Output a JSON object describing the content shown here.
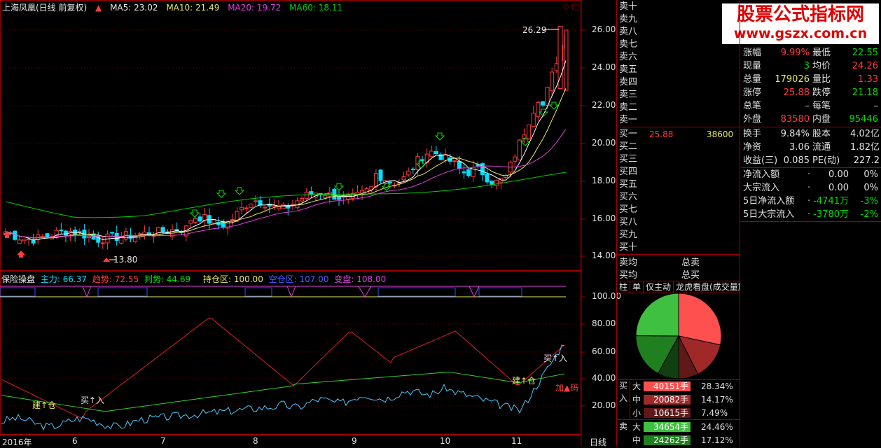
{
  "header": {
    "stock_title": "上海凤凰(日线 前复权)",
    "ma5": "MA5: 23.02",
    "ma10": "MA10: 21.49",
    "ma20": "MA20: 19.72",
    "ma60": "MA60: 18.11"
  },
  "main_chart": {
    "price_ticks": [
      "26.00",
      "24.00",
      "22.00",
      "20.00",
      "18.00",
      "16.00",
      "14.00"
    ],
    "high_label": "26.29",
    "low_label": "13.80"
  },
  "indicator": {
    "name": "保险操盘",
    "zhuli": "主力: 66.37",
    "qushi": "趋势: 72.55",
    "panshi": "判势: 44.69",
    "chicang": "持仓区: 100.00",
    "kongcang": "空仓区: 107.00",
    "biancang": "变盘: 108.00",
    "ticks": [
      "100.00",
      "80.00",
      "60.00",
      "40.00",
      "20.00"
    ],
    "annot_jiancang1": "建↑仓",
    "annot_mairu1": "买↑入",
    "annot_jiancang2": "建↑仓",
    "annot_mairu2": "买↑入",
    "annot_jiama": "加▲码"
  },
  "date_axis": {
    "labels": [
      "2016年",
      "6",
      "7",
      "8",
      "9",
      "10",
      "11"
    ],
    "period": "日线"
  },
  "watermark": {
    "title": "股票公式指标网",
    "url": "www.gszx.com.cn"
  },
  "order_book": {
    "sells": [
      "卖十",
      "卖九",
      "卖八",
      "卖七",
      "卖六",
      "卖五",
      "卖四",
      "卖三",
      "卖二",
      "卖一"
    ],
    "buys": [
      "买一",
      "买二",
      "买三",
      "买四",
      "买五",
      "买六",
      "买七",
      "买八",
      "买九",
      "买十"
    ],
    "buy1_price": "25.88",
    "buy1_vol": "38600",
    "avg_sell": "卖均",
    "avg_buy": "买均",
    "total_sell": "总卖",
    "total_buy": "总买"
  },
  "quote": {
    "rows": [
      {
        "l1": "涨幅",
        "v1": "9.99%",
        "c1": "red",
        "l2": "最低",
        "v2": "22.55",
        "c2": "green"
      },
      {
        "l1": "现量",
        "v1": "3",
        "c1": "green",
        "l2": "均价",
        "v2": "24.26",
        "c2": "red"
      },
      {
        "l1": "总量",
        "v1": "179026",
        "c1": "yellow",
        "l2": "量比",
        "v2": "1.33",
        "c2": "red"
      },
      {
        "l1": "涨停",
        "v1": "25.88",
        "c1": "red",
        "l2": "跌停",
        "v2": "21.18",
        "c2": "green"
      },
      {
        "l1": "总笔",
        "v1": "–",
        "c1": "white",
        "l2": "每笔",
        "v2": "–",
        "c2": "white"
      },
      {
        "l1": "外盘",
        "v1": "83580",
        "c1": "red",
        "l2": "内盘",
        "v2": "95446",
        "c2": "green"
      }
    ],
    "rows2": [
      {
        "l1": "换手",
        "v1": "9.84%",
        "l2": "股本",
        "v2": "4.02亿"
      },
      {
        "l1": "净资",
        "v1": "3.06",
        "l2": "流通",
        "v2": "1.82亿"
      },
      {
        "l1": "收益(三)",
        "v1": "0.085",
        "l2": "PE(动)",
        "v2": "227.2"
      }
    ],
    "flows": [
      {
        "label": "净流入额",
        "value": "0.00",
        "pct": "0%",
        "c": "white"
      },
      {
        "label": "大宗流入",
        "value": "0.00",
        "pct": "0%",
        "c": "white"
      },
      {
        "label": "5日净流入额",
        "value": "-4741万",
        "pct": "-3%",
        "c": "green"
      },
      {
        "label": "5日大宗流入",
        "value": "-3780万",
        "pct": "-2%",
        "c": "green"
      }
    ]
  },
  "tabs": [
    "柱",
    "单",
    "仅主动",
    "龙虎看盘(成交量族"
  ],
  "pie": {
    "slices": [
      {
        "name": "买大",
        "pct": 28.34,
        "color": "#ff5050"
      },
      {
        "name": "买中",
        "pct": 14.17,
        "color": "#a02828"
      },
      {
        "name": "买小",
        "pct": 7.49,
        "color": "#601818"
      },
      {
        "name": "卖小",
        "pct": 8.0,
        "color": "#104010"
      },
      {
        "name": "卖中",
        "pct": 17.12,
        "color": "#208020"
      },
      {
        "name": "卖大",
        "pct": 24.88,
        "color": "#40c040"
      }
    ]
  },
  "flow_table": {
    "buy_label": "买入",
    "sell_label": "卖",
    "rows": [
      {
        "size": "大",
        "vol": "40151手",
        "pct": "28.34%",
        "color": "#ff5050"
      },
      {
        "size": "中",
        "vol": "20082手",
        "pct": "14.17%",
        "color": "#a02828"
      },
      {
        "size": "小",
        "vol": "10615手",
        "pct": "7.49%",
        "color": "#601818"
      },
      {
        "size": "大",
        "vol": "34654手",
        "pct": "24.46%",
        "color": "#40c040"
      },
      {
        "size": "中",
        "vol": "24262手",
        "pct": "17.12%",
        "color": "#208020"
      }
    ]
  },
  "colors": {
    "up": "#ff3c3c",
    "down": "#00e0ff",
    "ma5": "#ffffff",
    "ma10": "#e8e860",
    "ma20": "#e040e0",
    "ma60": "#00d000"
  }
}
